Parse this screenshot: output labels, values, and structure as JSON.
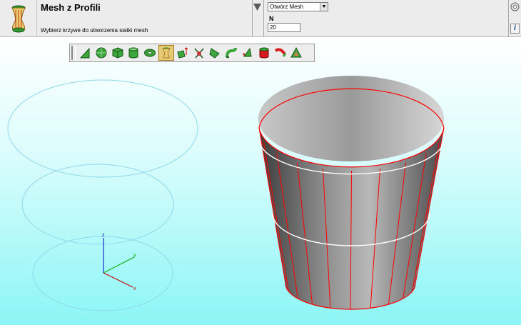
{
  "command": {
    "title": "Mesh z Profili",
    "hint": "Wybierz krzywe do utworzenia siatki mesh",
    "icon": "vase-mesh-icon"
  },
  "options": {
    "mode_select": {
      "value": "Otwórz Mesh",
      "options": [
        "Otwórz Mesh"
      ]
    },
    "n_label": "N",
    "n_value": "20"
  },
  "side_buttons": [
    {
      "icon": "target-circle-icon"
    },
    {
      "label": "i",
      "icon": "info-icon"
    }
  ],
  "toolbar": {
    "tools": [
      {
        "icon": "cone-icon",
        "active": false
      },
      {
        "icon": "sphere-icon",
        "active": false
      },
      {
        "icon": "box-icon",
        "active": false
      },
      {
        "icon": "cylinder-icon",
        "active": false
      },
      {
        "icon": "torus-icon",
        "active": false
      },
      {
        "icon": "profile-mesh-icon",
        "active": true
      },
      {
        "icon": "extrude-icon",
        "active": false
      },
      {
        "icon": "revolve-icon",
        "active": false
      },
      {
        "icon": "plane-mesh-icon",
        "active": false
      },
      {
        "icon": "pipe-icon",
        "active": false
      },
      {
        "icon": "add-mesh-icon",
        "active": false
      },
      {
        "icon": "color-cylinder-icon",
        "active": false
      },
      {
        "icon": "sweep-icon",
        "active": false
      },
      {
        "icon": "offset-mesh-icon",
        "active": false
      }
    ]
  },
  "axes": {
    "z": "z",
    "y": "y",
    "x": "x"
  },
  "colors": {
    "mesh_edge": "#ff0000",
    "profile_curve": "#ffffff",
    "construction_ellipse": "#8ed8ec",
    "axis_x": "#cc0000",
    "axis_y": "#00aa00",
    "axis_z": "#0000cc",
    "tool_active": "#e7c978"
  }
}
